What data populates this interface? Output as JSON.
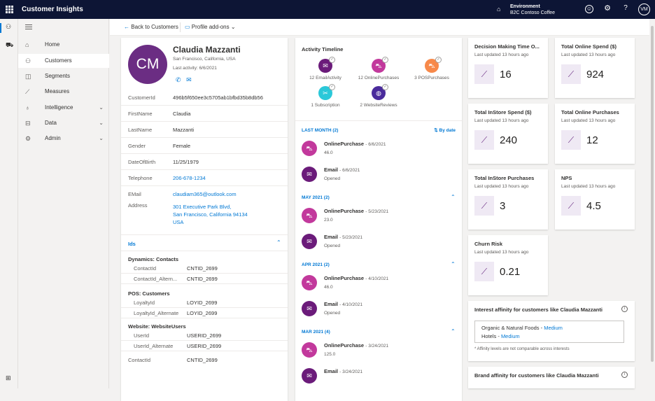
{
  "app": {
    "title": "Customer Insights",
    "env_label": "Environment",
    "env_name": "B2C Contoso Coffee",
    "user_initials": "VM"
  },
  "nav": {
    "items": [
      {
        "label": "Home",
        "icon": "home-icon",
        "glyph": "⌂"
      },
      {
        "label": "Customers",
        "icon": "customers-icon",
        "glyph": "⚇"
      },
      {
        "label": "Segments",
        "icon": "segments-icon",
        "glyph": "◫"
      },
      {
        "label": "Measures",
        "icon": "measures-icon",
        "glyph": "⟋"
      },
      {
        "label": "Intelligence",
        "icon": "lightbulb-icon",
        "glyph": "♁"
      },
      {
        "label": "Data",
        "icon": "database-icon",
        "glyph": "⊟"
      },
      {
        "label": "Admin",
        "icon": "gear-icon",
        "glyph": "⚙"
      }
    ]
  },
  "cmd": {
    "back": "Back to Customers",
    "addons": "Profile add-ons"
  },
  "profile": {
    "initials": "CM",
    "name": "Claudia Mazzanti",
    "location": "San Francisco, California, USA",
    "last_activity": "Last activity: 6/6/2021",
    "fields": [
      {
        "k": "CustomerId",
        "v": "496b5f650ee3c5705ab1bfbd35b8db56"
      },
      {
        "k": "FirstName",
        "v": "Claudia"
      },
      {
        "k": "LastName",
        "v": "Mazzanti"
      },
      {
        "k": "Gender",
        "v": "Female"
      },
      {
        "k": "DateOfBirth",
        "v": "11/25/1979"
      },
      {
        "k": "Telephone",
        "v": "206-678-1234"
      },
      {
        "k": "EMail",
        "v": "claudiam365@outlook.com"
      }
    ],
    "address_label": "Address",
    "address": [
      "301 Executive Park Blvd,",
      "San Francisco, California 94134",
      "USA"
    ],
    "ids_label": "Ids",
    "groups": [
      {
        "name": "Dynamics: Contacts",
        "rows": [
          {
            "k": "ContactId",
            "v": "CNTID_2699"
          },
          {
            "k": "ContactId_Altern...",
            "v": "CNTID_2699"
          }
        ]
      },
      {
        "name": "POS: Customers",
        "rows": [
          {
            "k": "LoyaltyId",
            "v": "LOYID_2699"
          },
          {
            "k": "LoyaltyId_Alternate",
            "v": "LOYID_2699"
          }
        ]
      },
      {
        "name": "Website: WebsiteUsers",
        "rows": [
          {
            "k": "UserId",
            "v": "USERID_2699"
          },
          {
            "k": "UserId_Alternate",
            "v": "USERID_2699"
          }
        ]
      }
    ],
    "contact_id": {
      "k": "ContactId",
      "v": "CNTID_2699"
    }
  },
  "timeline": {
    "title": "Activity Timeline",
    "sort": "By date",
    "activities": [
      {
        "label": "12 EmailActivity",
        "color": "#6b1b7a",
        "glyph": "✉"
      },
      {
        "label": "12 OnlinePurchases",
        "color": "#c2399c",
        "glyph": "⛍"
      },
      {
        "label": "3 POSPurchases",
        "color": "#f7894a",
        "glyph": "⛍"
      },
      {
        "label": "1 Subscription",
        "color": "#2bc8d9",
        "glyph": "✂"
      },
      {
        "label": "2 WebsiteReviews",
        "color": "#4a2b9c",
        "glyph": "◍"
      }
    ],
    "sections": [
      {
        "title": "LAST MONTH (2)",
        "items": [
          {
            "t": "OnlinePurchase",
            "d": "6/6/2021",
            "s": "46.0",
            "kind": "purchase"
          },
          {
            "t": "Email",
            "d": "6/6/2021",
            "s": "Opened",
            "kind": "email"
          }
        ]
      },
      {
        "title": "MAY 2021 (2)",
        "items": [
          {
            "t": "OnlinePurchase",
            "d": "5/23/2021",
            "s": "23.0",
            "kind": "purchase"
          },
          {
            "t": "Email",
            "d": "5/23/2021",
            "s": "Opened",
            "kind": "email"
          }
        ]
      },
      {
        "title": "APR 2021 (2)",
        "items": [
          {
            "t": "OnlinePurchase",
            "d": "4/10/2021",
            "s": "46.0",
            "kind": "purchase"
          },
          {
            "t": "Email",
            "d": "4/10/2021",
            "s": "Opened",
            "kind": "email"
          }
        ]
      },
      {
        "title": "MAR 2021 (4)",
        "items": [
          {
            "t": "OnlinePurchase",
            "d": "3/24/2021",
            "s": "125.0",
            "kind": "purchase"
          },
          {
            "t": "Email",
            "d": "3/24/2021",
            "s": "",
            "kind": "email"
          }
        ]
      }
    ]
  },
  "measures": [
    {
      "title": "Decision Making Time O...",
      "updated": "Last updated 13 hours ago",
      "value": "16"
    },
    {
      "title": "Total Online Spend ($)",
      "updated": "Last updated 13 hours ago",
      "value": "924"
    },
    {
      "title": "Total InStore Spend ($)",
      "updated": "Last updated 13 hours ago",
      "value": "240"
    },
    {
      "title": "Total Online Purchases",
      "updated": "Last updated 13 hours ago",
      "value": "12"
    },
    {
      "title": "Total InStore Purchases",
      "updated": "Last updated 13 hours ago",
      "value": "3"
    },
    {
      "title": "NPS",
      "updated": "Last updated 13 hours ago",
      "value": "4.5"
    },
    {
      "title": "Churn Risk",
      "updated": "Last updated 13 hours ago",
      "value": "0.21"
    }
  ],
  "interest": {
    "title": "Interest affinity for customers like Claudia Mazzanti",
    "items": [
      {
        "name": "Organic & Natural Foods",
        "level": "Medium"
      },
      {
        "name": "Hotels",
        "level": "Medium"
      }
    ],
    "note": "* Affinity levels are not comparable across interests"
  },
  "brand": {
    "title": "Brand affinity for customers like Claudia Mazzanti"
  }
}
